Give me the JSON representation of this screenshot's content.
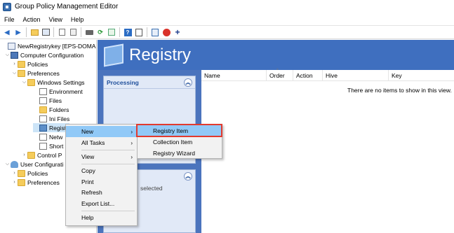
{
  "window": {
    "title": "Group Policy Management Editor"
  },
  "menu": [
    "File",
    "Action",
    "View",
    "Help"
  ],
  "tree": {
    "root": "NewRegistrykey [EPS-DOMAIN.",
    "computer_config": "Computer Configuration",
    "policies": "Policies",
    "preferences": "Preferences",
    "windows_settings": "Windows Settings",
    "environment": "Environment",
    "files": "Files",
    "folders": "Folders",
    "ini_files": "Ini Files",
    "registry": "Regist",
    "network": "Netw",
    "shortcuts": "Short",
    "control_panel": "Control P",
    "user_config": "User Configurati",
    "user_policies": "Policies",
    "user_preferences": "Preferences"
  },
  "banner": {
    "title": "Registry"
  },
  "processing": {
    "title": "Processing"
  },
  "description": {
    "text": "selected"
  },
  "grid": {
    "columns": [
      "Name",
      "Order",
      "Action",
      "Hive",
      "Key"
    ],
    "empty_message": "There are no items to show in this view."
  },
  "context_menu": {
    "new": "New",
    "all_tasks": "All Tasks",
    "view": "View",
    "copy": "Copy",
    "print": "Print",
    "refresh": "Refresh",
    "export_list": "Export List...",
    "help": "Help"
  },
  "submenu": {
    "registry_item": "Registry Item",
    "collection_item": "Collection Item",
    "registry_wizard": "Registry Wizard"
  },
  "colors": {
    "banner": "#3f6fbf",
    "highlight_box": "#e23a2e",
    "hover": "#91c9f7"
  }
}
